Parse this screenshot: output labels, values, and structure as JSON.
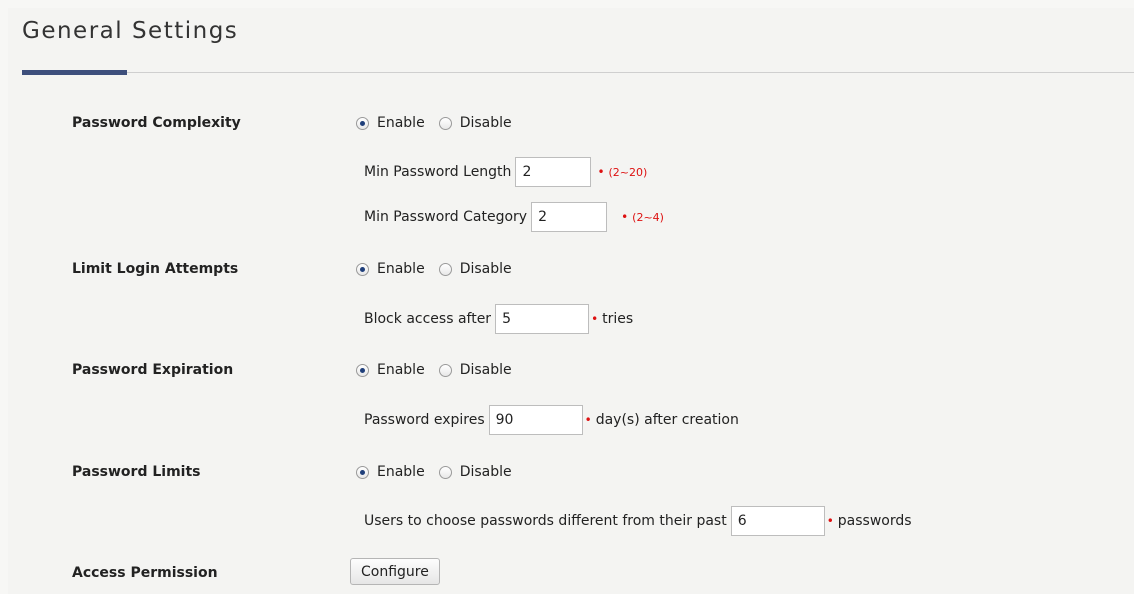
{
  "page": {
    "title": "General Settings"
  },
  "radio": {
    "enable": "Enable",
    "disable": "Disable"
  },
  "password_complexity": {
    "label": "Password Complexity",
    "selected": "Enable",
    "min_length_label": "Min Password Length",
    "min_length_value": "2",
    "min_length_hint": "(2~20)",
    "min_category_label": "Min Password Category",
    "min_category_value": "2",
    "min_category_hint": "(2~4)"
  },
  "limit_login": {
    "label": "Limit Login Attempts",
    "selected": "Enable",
    "prefix": "Block access after",
    "value": "5",
    "suffix": "tries"
  },
  "password_expiration": {
    "label": "Password Expiration",
    "selected": "Enable",
    "prefix": "Password expires",
    "value": "90",
    "suffix": "day(s) after creation"
  },
  "password_limits": {
    "label": "Password Limits",
    "selected": "Enable",
    "prefix": "Users to choose passwords different from their past",
    "value": "6",
    "suffix": "passwords"
  },
  "access_permission": {
    "label": "Access Permission",
    "button": "Configure"
  },
  "required_marker": "•",
  "colors": {
    "accent": "#3d4f7c",
    "required": "#dd1111"
  }
}
